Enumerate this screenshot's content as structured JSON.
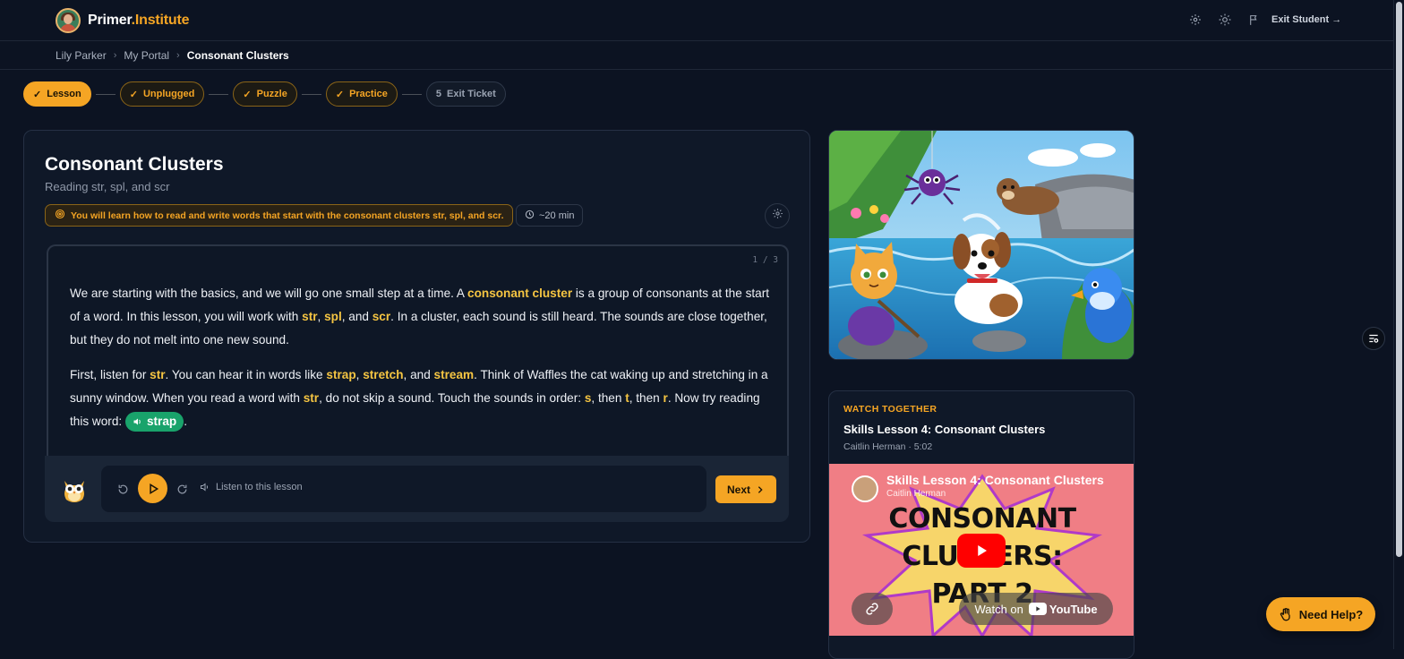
{
  "brand": {
    "name_a": "Primer",
    "name_b": ".Institute"
  },
  "topbar": {
    "exit_label": "Exit Student →",
    "icons": [
      "gear-icon",
      "sun-icon",
      "flag-icon"
    ]
  },
  "breadcrumbs": [
    "Lily Parker",
    "My Portal",
    "Consonant Clusters"
  ],
  "steps": [
    {
      "label": "Lesson",
      "state": "active",
      "marker": "✓"
    },
    {
      "label": "Unplugged",
      "state": "done",
      "marker": "✓"
    },
    {
      "label": "Puzzle",
      "state": "done",
      "marker": "✓"
    },
    {
      "label": "Practice",
      "state": "done",
      "marker": "✓"
    },
    {
      "label": "Exit Ticket",
      "state": "todo",
      "marker": "5"
    }
  ],
  "lesson": {
    "title": "Consonant Clusters",
    "subtitle": "Reading str, spl, and scr",
    "goal": "You will learn how to read and write words that start with the consonant clusters str, spl, and scr.",
    "duration": "~20 min",
    "page_indicator": "1 / 3",
    "p1": {
      "t1": "We are starting with the basics, and we will go one small step at a time. A ",
      "h1": "consonant cluster",
      "t2": " is a group of consonants at the start of a word. In this lesson, you will work with ",
      "h2": "str",
      "t3": ", ",
      "h3": "spl",
      "t4": ", and ",
      "h4": "scr",
      "t5": ". In a cluster, each sound is still heard. The sounds are close together, but they do not melt into one new sound."
    },
    "p2": {
      "t1": "First, listen for ",
      "h1": "str",
      "t2": ". You can hear it in words like ",
      "h2": "strap",
      "t3": ", ",
      "h3": "stretch",
      "t4": ", and ",
      "h4": "stream",
      "t5": ". Think of Waffles the cat waking up and stretching in a sunny window. When you read a word with ",
      "h5": "str",
      "t6": ", do not skip a sound. Touch the sounds in order: ",
      "h6": "s",
      "t7": ", then ",
      "h7": "t",
      "t8": ", then ",
      "h8": "r",
      "t9": ". Now try reading this word: ",
      "chip": "strap",
      "t10": "."
    }
  },
  "player": {
    "listen_label": "Listen to this lesson",
    "next_label": "Next"
  },
  "video": {
    "kicker": "WATCH TOGETHER",
    "title": "Skills Lesson 4: Consonant Clusters",
    "meta": "Caitlin Herman · 5:02",
    "embed_title": "Skills Lesson 4: Consonant Clusters",
    "embed_channel": "Caitlin Herman",
    "thumb_line1": "CONSONANT",
    "thumb_line2": "CLUSTERS:",
    "thumb_line3": "PART 2",
    "watch_on": "Watch on",
    "youtube": "YouTube"
  },
  "help_label": "Need Help?",
  "colors": {
    "accent": "#f5a524",
    "background": "#0c1322",
    "success": "#19a36b"
  }
}
